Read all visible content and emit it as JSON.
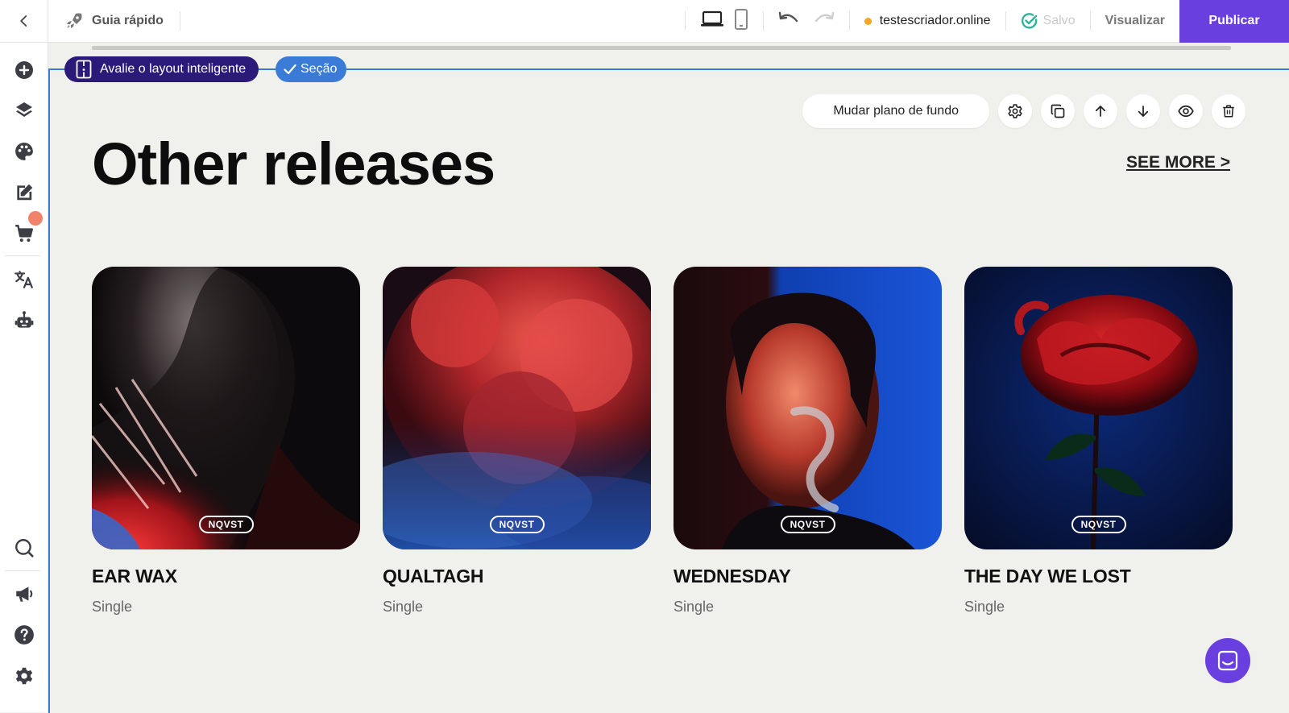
{
  "topbar": {
    "guide_label": "Guia rápido",
    "domain": "testescriador.online",
    "saved_label": "Salvo",
    "preview_label": "Visualizar",
    "publish_label": "Publicar"
  },
  "colors": {
    "accent": "#6a3fe0",
    "selection": "#3b7bd8",
    "ai_pill": "#2b1a7a",
    "canvas_bg": "#f0f0ec",
    "saved_check": "#2fb39a",
    "domain_dot": "#f5a623",
    "cart_badge": "#f0836a"
  },
  "sidebar": {
    "items": [
      {
        "icon": "add-icon"
      },
      {
        "icon": "layers-icon"
      },
      {
        "icon": "palette-icon"
      },
      {
        "icon": "edit-icon"
      },
      {
        "icon": "cart-icon"
      },
      {
        "icon": "translate-icon"
      },
      {
        "icon": "robot-icon"
      },
      {
        "icon": "search-icon"
      },
      {
        "icon": "megaphone-icon"
      },
      {
        "icon": "help-icon"
      },
      {
        "icon": "settings-icon"
      }
    ]
  },
  "editor": {
    "ai_pill_label": "Avalie o layout inteligente",
    "section_pill_label": "Seção",
    "change_background_label": "Mudar plano de fundo"
  },
  "section": {
    "heading": "Other releases",
    "see_more": "SEE MORE >",
    "cards": [
      {
        "title": "EAR WAX",
        "subtitle": "Single",
        "tag": "NQVST"
      },
      {
        "title": "QUALTAGH",
        "subtitle": "Single",
        "tag": "NQVST"
      },
      {
        "title": "WEDNESDAY",
        "subtitle": "Single",
        "tag": "NQVST"
      },
      {
        "title": "THE DAY WE LOST",
        "subtitle": "Single",
        "tag": "NQVST"
      }
    ]
  }
}
